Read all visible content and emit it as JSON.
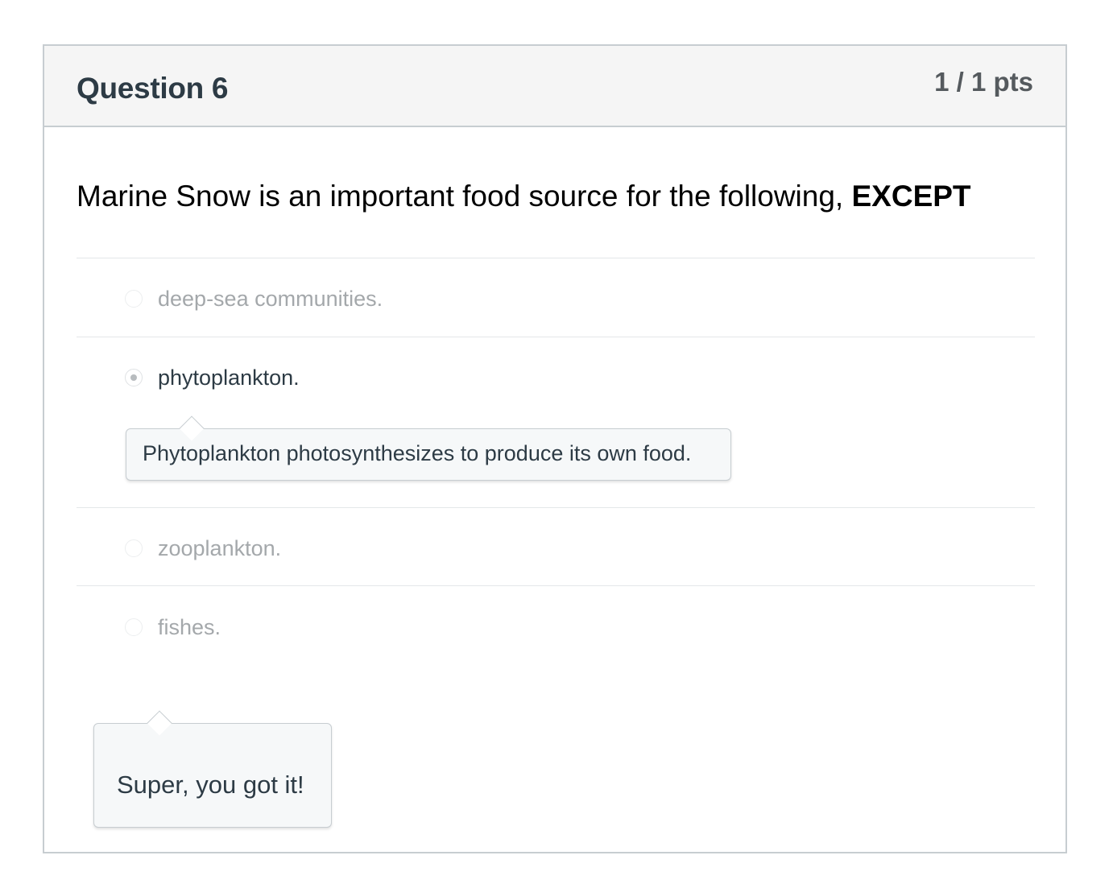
{
  "question": {
    "title": "Question 6",
    "points": "1 / 1 pts",
    "text_before": "Marine Snow is an important food source for the following, ",
    "text_emphasis": "EXCEPT"
  },
  "answers": [
    {
      "label": "deep-sea communities.",
      "selected": false
    },
    {
      "label": "phytoplankton.",
      "selected": true,
      "comment": "Phytoplankton photosynthesizes to produce its own food."
    },
    {
      "label": "zooplankton.",
      "selected": false
    },
    {
      "label": "fishes.",
      "selected": false
    }
  ],
  "feedback": {
    "correct_comment": "Super, you got it!"
  }
}
